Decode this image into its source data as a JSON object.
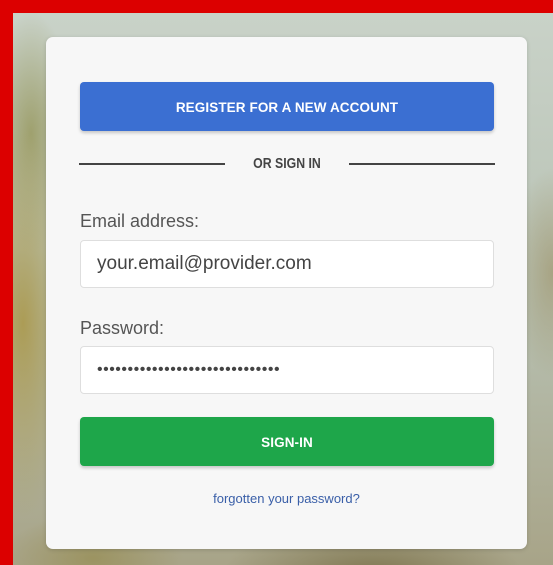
{
  "register_button": {
    "label": "REGISTER FOR A NEW ACCOUNT"
  },
  "divider": {
    "label": "OR SIGN IN"
  },
  "email": {
    "label": "Email address:",
    "value": "your.email@provider.com"
  },
  "password": {
    "label": "Password:",
    "value": "••••••••••••••••••••••••••••••"
  },
  "signin_button": {
    "label": "SIGN-IN"
  },
  "forgot_link": {
    "label": "forgotten your password?"
  },
  "colors": {
    "frame": "#dc0000",
    "register": "#3b6fd2",
    "signin": "#1ea64a",
    "link": "#3a5fa8"
  }
}
